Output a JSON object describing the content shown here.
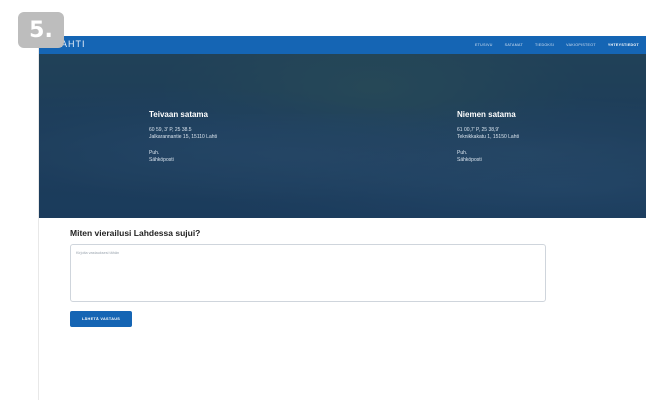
{
  "step_badge": "5.",
  "header": {
    "logo": "AHTI",
    "nav": [
      {
        "label": "ETUSIVU",
        "active": false
      },
      {
        "label": "SATAMAT",
        "active": false
      },
      {
        "label": "TIEDOKSI",
        "active": false
      },
      {
        "label": "VAKIOPISTEOT",
        "active": false
      },
      {
        "label": "YHTEYSTIEDOT",
        "active": true
      }
    ]
  },
  "harbors": [
    {
      "name": "Teivaan satama",
      "coords": "60 59, 3' P, 25 38.5",
      "address": "Jalkarannantie 15, 15110 Lahti",
      "phone_label": "Puh.",
      "email_label": "Sähköposti"
    },
    {
      "name": "Niemen satama",
      "coords": "61 00,7' P, 25 38,9'",
      "address": "Teknikkakatu 1, 15150 Lahti",
      "phone_label": "Puh.",
      "email_label": "Sähköposti"
    }
  ],
  "feedback": {
    "question": "Miten vierailusi Lahdessa sujui?",
    "placeholder": "Kirjoita vastauksesi tähän",
    "submit_label": "LÄHETÄ VASTAUS"
  },
  "colors": {
    "brand_blue": "#1565b4",
    "badge_gray": "#bdbdbd"
  }
}
